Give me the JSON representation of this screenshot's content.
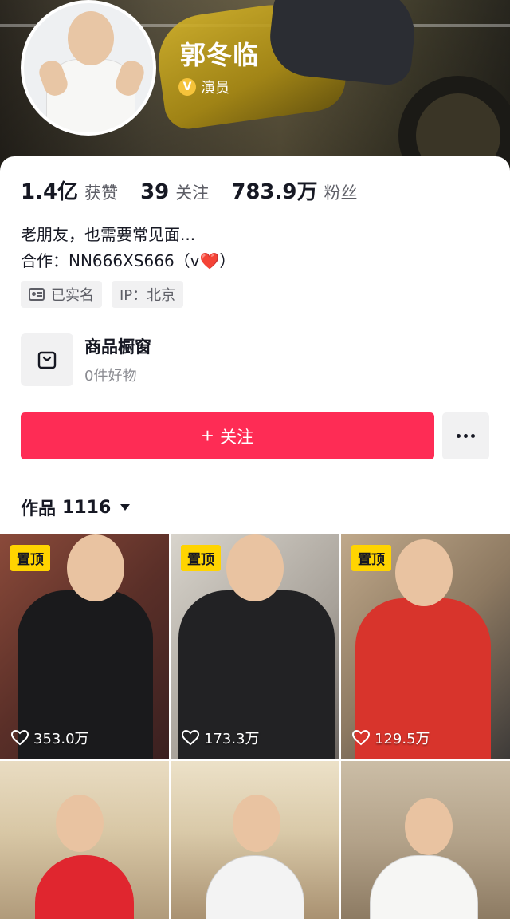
{
  "profile": {
    "name": "郭冬临",
    "verify_label": "演员"
  },
  "stats": [
    {
      "value": "1.4亿",
      "label": "获赞"
    },
    {
      "value": "39",
      "label": "关注"
    },
    {
      "value": "783.9万",
      "label": "粉丝"
    }
  ],
  "bio": {
    "line1": "老朋友，也需要常见面...",
    "line2_prefix": "合作：NN666XS666（v",
    "line2_heart": "❤️",
    "line2_suffix": "）"
  },
  "tags": {
    "verified": "已实名",
    "ip": "IP：北京"
  },
  "shop": {
    "title": "商品橱窗",
    "subtitle": "0件好物"
  },
  "actions": {
    "follow_plus": "+",
    "follow_label": "关注"
  },
  "works": {
    "title": "作品",
    "count": "1116"
  },
  "videos": [
    {
      "pin": "置顶",
      "likes": "353.0万"
    },
    {
      "pin": "置顶",
      "likes": "173.3万"
    },
    {
      "pin": "置顶",
      "likes": "129.5万"
    },
    {
      "pin": "",
      "likes": ""
    },
    {
      "pin": "",
      "likes": ""
    },
    {
      "pin": "",
      "likes": ""
    }
  ],
  "colors": {
    "accent": "#fe2c55",
    "pin_badge": "#ffd400",
    "verify_badge": "#f5c33b"
  },
  "icons": {
    "verify": "verified-v-icon",
    "id_card": "id-card-icon",
    "shop": "shopping-bag-icon",
    "more": "more-dots-icon",
    "heart": "heart-outline-icon",
    "caret": "caret-down-icon"
  }
}
